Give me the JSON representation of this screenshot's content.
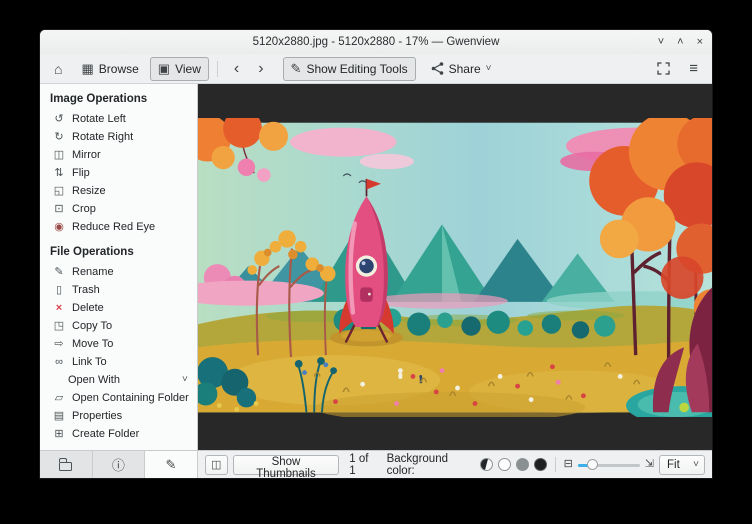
{
  "window": {
    "title": "5120x2880.jpg - 5120x2880 - 17% — Gwenview",
    "minimize_glyph": "˅",
    "maximize_glyph": "˄",
    "close_glyph": "×"
  },
  "toolbar": {
    "home_icon": "⌂",
    "browse": {
      "label": "Browse",
      "icon": "▦"
    },
    "view": {
      "label": "View",
      "icon": "▣"
    },
    "back_icon": "‹",
    "forward_icon": "›",
    "editing_tools": {
      "label": "Show Editing Tools",
      "icon": "✎"
    },
    "share": {
      "label": "Share",
      "chevron": "˅",
      "icon_name": "share-nodes-icon"
    },
    "fullscreen_icon_name": "fit-fullscreen-icon",
    "menu_icon": "≡"
  },
  "sidebar": {
    "image_operations": {
      "header": "Image Operations",
      "items": [
        {
          "label": "Rotate Left",
          "icon": "↺"
        },
        {
          "label": "Rotate Right",
          "icon": "↻"
        },
        {
          "label": "Mirror",
          "icon": "◫"
        },
        {
          "label": "Flip",
          "icon": "⇅"
        },
        {
          "label": "Resize",
          "icon": "◱"
        },
        {
          "label": "Crop",
          "icon": "⊡"
        },
        {
          "label": "Reduce Red Eye",
          "icon": "◉"
        }
      ]
    },
    "file_operations": {
      "header": "File Operations",
      "items": [
        {
          "label": "Rename",
          "icon": "✎"
        },
        {
          "label": "Trash",
          "icon": "▯"
        },
        {
          "label": "Delete",
          "icon": "×"
        },
        {
          "label": "Copy To",
          "icon": "◳"
        },
        {
          "label": "Move To",
          "icon": "⇨"
        },
        {
          "label": "Link To",
          "icon": "∞"
        }
      ],
      "open_with": {
        "label": "Open With",
        "chevron": "˅"
      },
      "more_items": [
        {
          "label": "Open Containing Folder",
          "icon": "▱"
        },
        {
          "label": "Properties",
          "icon": "▤"
        },
        {
          "label": "Create Folder",
          "icon": "⊞"
        }
      ]
    },
    "tabs": {
      "folder_icon": "folder",
      "info_icon": "ⓘ",
      "edit_icon": "✎"
    }
  },
  "statusbar": {
    "thumbnail_bar_icon": "◫",
    "show_thumbnails_label": "Show Thumbnails",
    "counter": "1 of 1",
    "background_color_label": "Background color:",
    "swatches": [
      "auto",
      "white",
      "gray",
      "black"
    ],
    "zoom_out_icon": "⊟",
    "zoom_fit_icon": "⇲",
    "zoom_value": "Fit",
    "combo_chevron": "˅"
  },
  "colors": {
    "accent": "#3daee9",
    "delete_red": "#da4453",
    "viewer_background": "#282828",
    "swatch_white": "#ffffff",
    "swatch_gray": "#8a8f91",
    "swatch_black": "#1d1f21"
  }
}
